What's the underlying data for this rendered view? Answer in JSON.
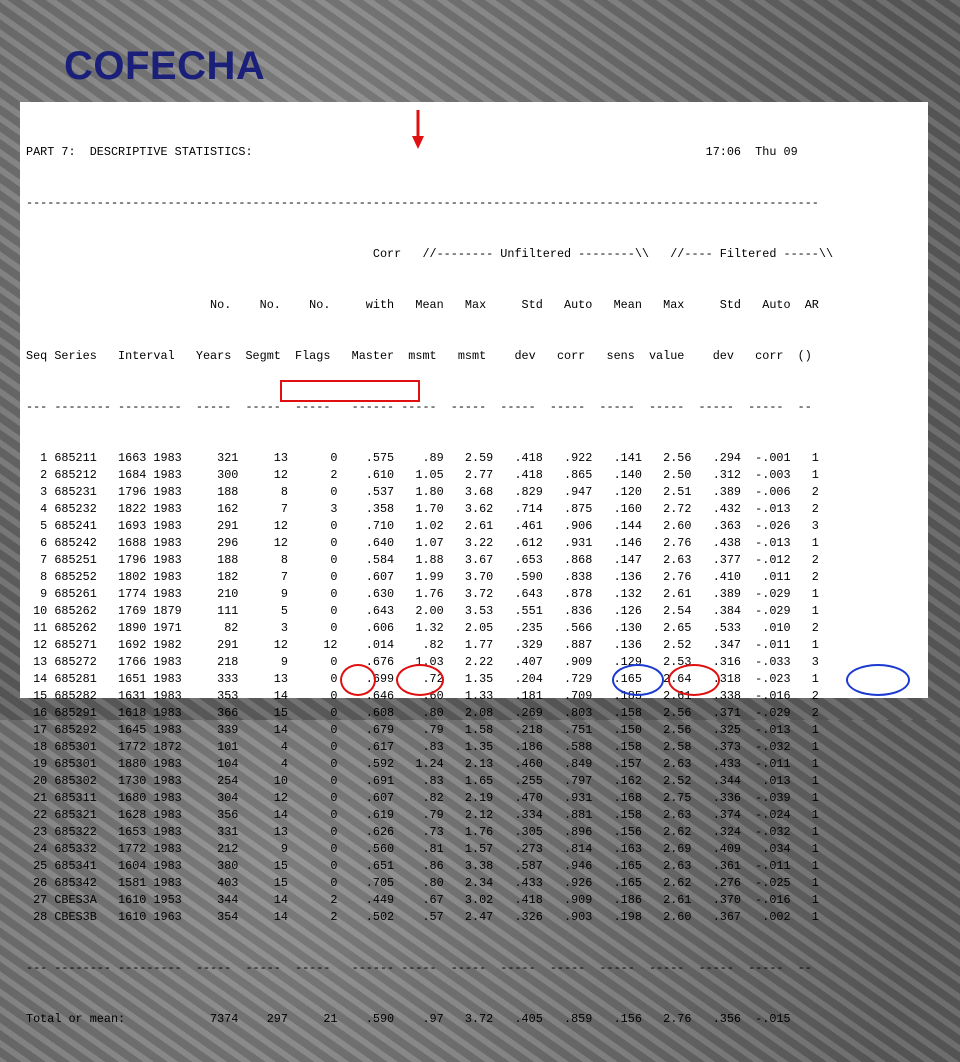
{
  "title": "COFECHA",
  "report": {
    "header": "PART 7:  DESCRIPTIVE STATISTICS:                                                                17:06  Thu 09",
    "rule": "----------------------------------------------------------------------------------------------------------------",
    "col_line1": "                                                 Corr   //-------- Unfiltered --------\\\\   //---- Filtered -----\\\\",
    "col_line2": "                          No.    No.    No.     with   Mean   Max     Std   Auto   Mean   Max     Std   Auto  AR",
    "col_line3": "Seq Series   Interval   Years  Segmt  Flags   Master  msmt   msmt    dev   corr   sens  value    dev   corr  ()",
    "dash_line": "--- -------- ---------  -----  -----  -----   ------ -----  -----  -----  -----  -----  -----  -----  -----  --",
    "rows": [
      "  1 685211   1663 1983     321     13      0    .575    .89   2.59   .418   .922   .141   2.56   .294  -.001   1",
      "  2 685212   1684 1983     300     12      2    .610   1.05   2.77   .418   .865   .140   2.50   .312  -.003   1",
      "  3 685231   1796 1983     188      8      0    .537   1.80   3.68   .829   .947   .120   2.51   .389  -.006   2",
      "  4 685232   1822 1983     162      7      3    .358   1.70   3.62   .714   .875   .160   2.72   .432  -.013   2",
      "  5 685241   1693 1983     291     12      0    .710   1.02   2.61   .461   .906   .144   2.60   .363  -.026   3",
      "  6 685242   1688 1983     296     12      0    .640   1.07   3.22   .612   .931   .146   2.76   .438  -.013   1",
      "  7 685251   1796 1983     188      8      0    .584   1.88   3.67   .653   .868   .147   2.63   .377  -.012   2",
      "  8 685252   1802 1983     182      7      0    .607   1.99   3.70   .590   .838   .136   2.76   .410   .011   2",
      "  9 685261   1774 1983     210      9      0    .630   1.76   3.72   .643   .878   .132   2.61   .389  -.029   1",
      " 10 685262   1769 1879     111      5      0    .643   2.00   3.53   .551   .836   .126   2.54   .384  -.029   1",
      " 11 685262   1890 1971      82      3      0    .606   1.32   2.05   .235   .566   .130   2.65   .533   .010   2",
      " 12 685271   1692 1982     291     12     12    .014    .82   1.77   .329   .887   .136   2.52   .347  -.011   1",
      " 13 685272   1766 1983     218      9      0    .676   1.03   2.22   .407   .909   .129   2.53   .316  -.033   3",
      " 14 685281   1651 1983     333     13      0    .699    .72   1.35   .204   .729   .165   2.64   .318  -.023   1",
      " 15 685282   1631 1983     353     14      0    .646    .60   1.33   .181   .709   .185   2.61   .338  -.016   2",
      " 16 685291   1618 1983     366     15      0    .608    .80   2.08   .269   .803   .158   2.56   .371  -.029   2",
      " 17 685292   1645 1983     339     14      0    .679    .79   1.58   .218   .751   .150   2.56   .325  -.013   1",
      " 18 685301   1772 1872     101      4      0    .617    .83   1.35   .186   .588   .158   2.58   .373  -.032   1",
      " 19 685301   1880 1983     104      4      0    .592   1.24   2.13   .460   .849   .157   2.63   .433  -.011   1",
      " 20 685302   1730 1983     254     10      0    .691    .83   1.65   .255   .797   .162   2.52   .344   .013   1",
      " 21 685311   1680 1983     304     12      0    .607    .82   2.19   .470   .931   .168   2.75   .336  -.039   1",
      " 22 685321   1628 1983     356     14      0    .619    .79   2.12   .334   .881   .158   2.63   .374  -.024   1",
      " 23 685322   1653 1983     331     13      0    .626    .73   1.76   .305   .896   .156   2.62   .324  -.032   1",
      " 24 685332   1772 1983     212      9      0    .560    .81   1.57   .273   .814   .163   2.69   .409   .034   1",
      " 25 685341   1604 1983     380     15      0    .651    .86   3.38   .587   .946   .165   2.63   .361  -.011   1",
      " 26 685342   1581 1983     403     15      0    .705    .80   2.34   .433   .926   .165   2.62   .276  -.025   1",
      " 27 CBES3A   1610 1953     344     14      2    .449    .67   3.02   .418   .909   .186   2.61   .370  -.016   1",
      " 28 CBES3B   1610 1963     354     14      2    .502    .57   2.47   .326   .903   .198   2.60   .367   .002   1"
    ],
    "total": "Total or mean:            7374    297     21    .590    .97   3.72   .405   .859   .156   2.76   .356  -.015"
  },
  "colors": {
    "title": "#1a1f7a",
    "red_mark": "#e01010",
    "blue_mark": "#1a3ad0"
  }
}
